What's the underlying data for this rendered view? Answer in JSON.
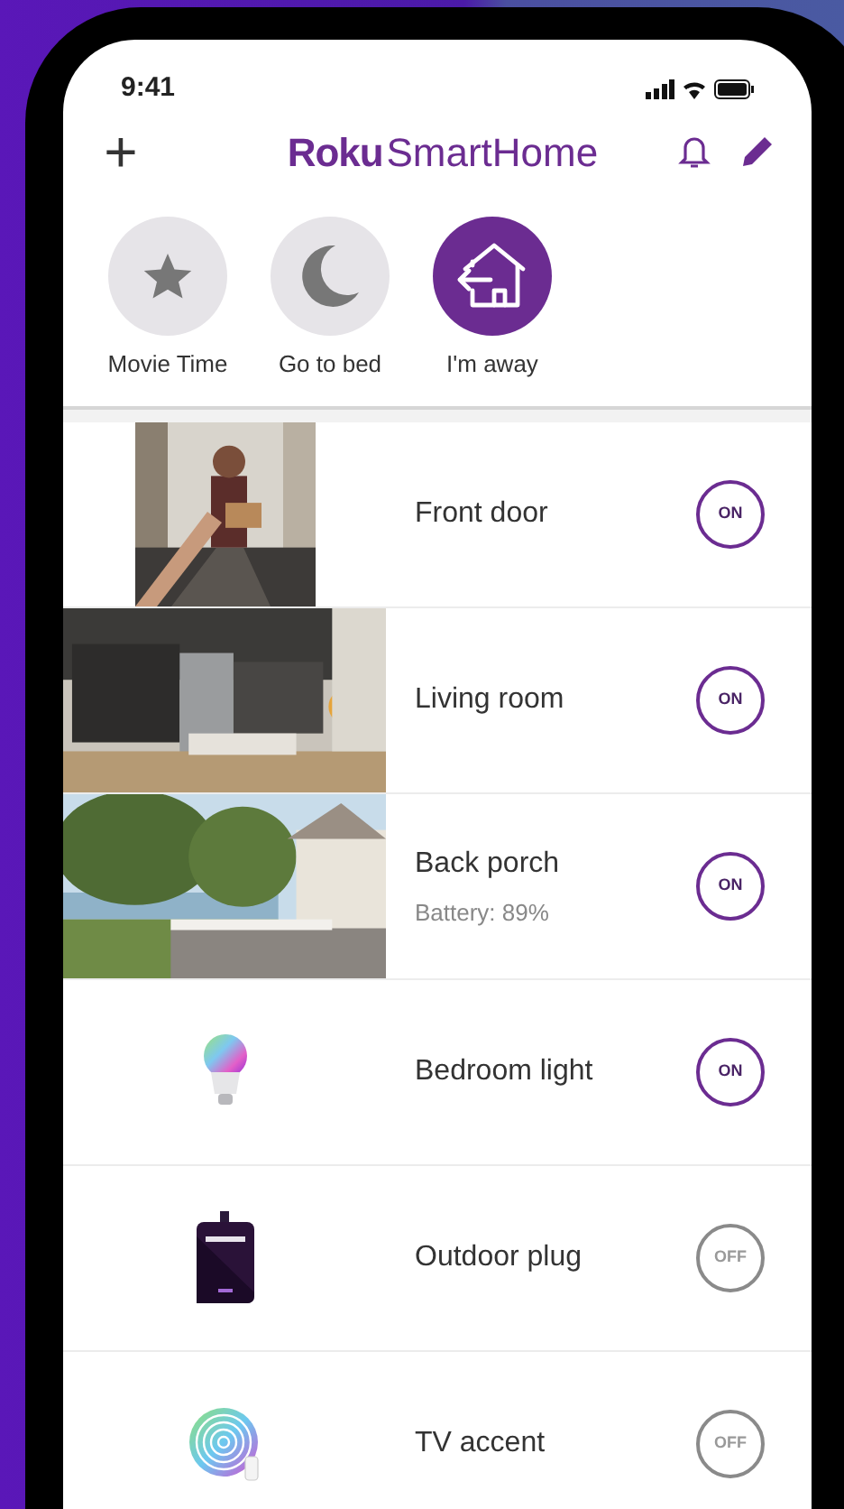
{
  "status_bar": {
    "time": "9:41"
  },
  "header": {
    "add_icon": "+",
    "logo": {
      "brand": "Roku",
      "product": "SmartHome"
    }
  },
  "scenes": [
    {
      "label": "Movie Time",
      "kind": "star",
      "selected": false
    },
    {
      "label": "Go to bed",
      "kind": "moon",
      "selected": false
    },
    {
      "label": "I'm away",
      "kind": "away",
      "selected": true
    }
  ],
  "devices": [
    {
      "name": "Front door",
      "kind": "doorbell",
      "on": true,
      "toggle": "ON"
    },
    {
      "name": "Living room",
      "kind": "camera",
      "on": true,
      "toggle": "ON"
    },
    {
      "name": "Back porch",
      "detail": "Battery: 89%",
      "kind": "camera",
      "on": true,
      "toggle": "ON"
    },
    {
      "name": "Bedroom light",
      "kind": "bulb",
      "on": true,
      "toggle": "ON"
    },
    {
      "name": "Outdoor plug",
      "kind": "plug",
      "on": false,
      "toggle": "OFF"
    },
    {
      "name": "TV accent",
      "kind": "lightstrip",
      "on": false,
      "toggle": "OFF"
    }
  ]
}
